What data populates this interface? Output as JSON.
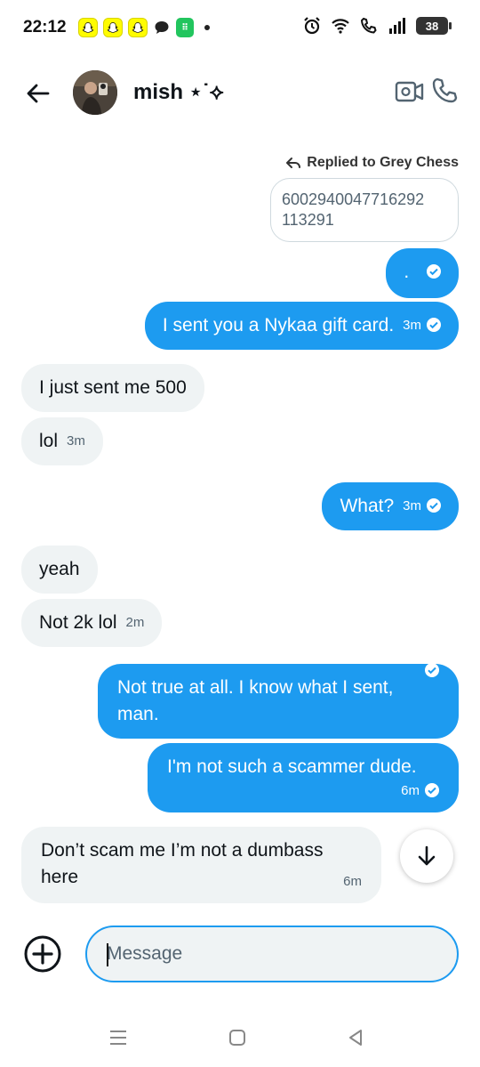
{
  "status_bar": {
    "time": "22:12",
    "battery": "38",
    "notification_icons": [
      "snapchat-icon",
      "snapchat-icon",
      "snapchat-icon",
      "chat-icon",
      "app-icon"
    ],
    "system_icons": [
      "alarm-icon",
      "wifi-icon",
      "wifi-call-icon",
      "signal-icon",
      "battery-icon"
    ]
  },
  "header": {
    "contact_name": "mish ⋆˙⟡",
    "back_icon": "arrow-left-icon",
    "video_icon": "video-call-icon",
    "call_icon": "phone-icon"
  },
  "conversation": {
    "reply_label": "Replied to Grey Chess",
    "quoted_text": "6002940047716292\n113291",
    "messages": [
      {
        "side": "out",
        "text": ".",
        "time": "",
        "read": true
      },
      {
        "side": "out",
        "text": "I sent you a Nykaa gift card.",
        "time": "3m",
        "read": true
      },
      {
        "side": "in",
        "text": "I just sent me 500",
        "time": ""
      },
      {
        "side": "in",
        "text": "lol",
        "time": "3m"
      },
      {
        "side": "out",
        "text": "What?",
        "time": "3m",
        "read": true
      },
      {
        "side": "in",
        "text": "yeah",
        "time": ""
      },
      {
        "side": "in",
        "text": "Not 2k lol",
        "time": "2m"
      },
      {
        "side": "out",
        "text": "Not true at all. I know what I sent, man.",
        "time": "",
        "read": true
      },
      {
        "side": "out",
        "text": "I'm not such a scammer dude.",
        "time": "6m",
        "read": true
      },
      {
        "side": "in",
        "text": "Don’t scam me I’m not a dumbass here",
        "time": "6m"
      }
    ]
  },
  "composer": {
    "placeholder": "Message",
    "value": ""
  },
  "colors": {
    "accent": "#1d9bf0",
    "incoming_bubble": "#eff3f4"
  }
}
